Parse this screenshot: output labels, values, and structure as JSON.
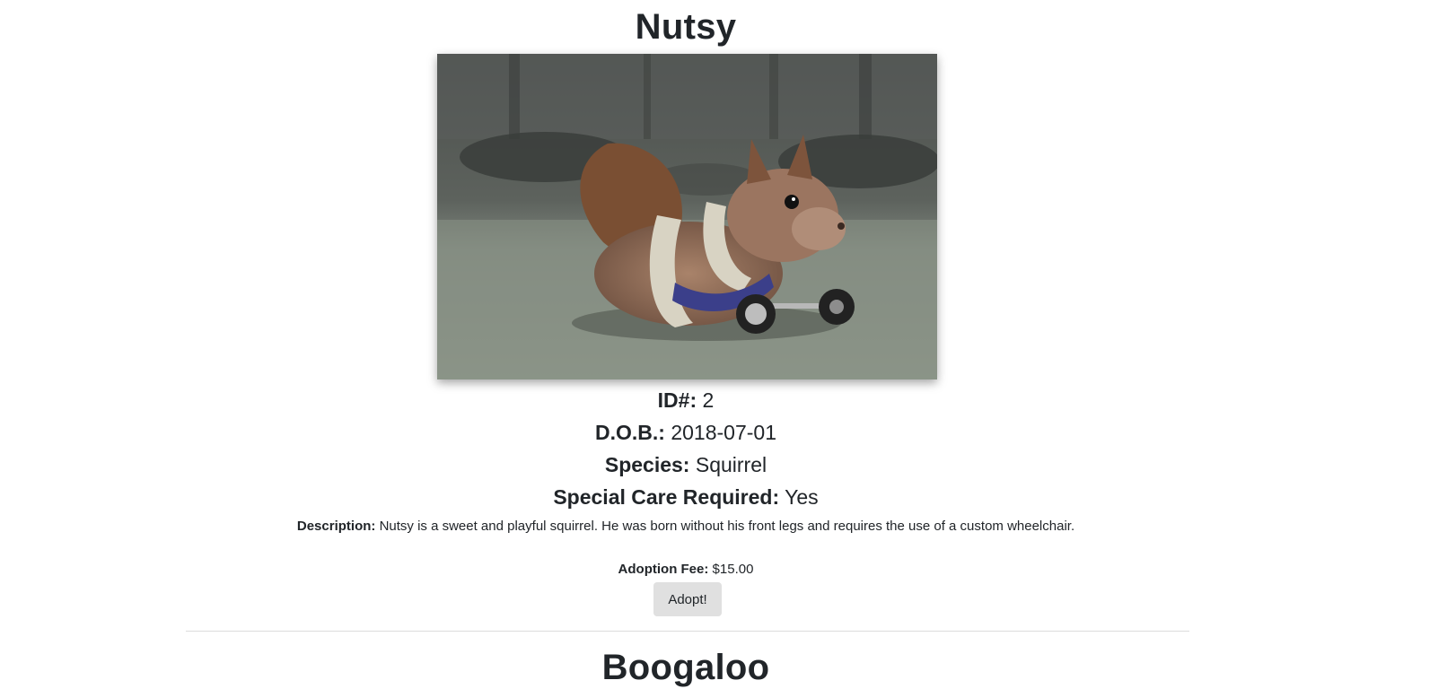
{
  "pets": [
    {
      "name": "Nutsy",
      "image_alt": "squirrel-with-wheelchair-photo",
      "id_label": "ID#:",
      "id_value": "2",
      "dob_label": "D.O.B.:",
      "dob_value": "2018-07-01",
      "species_label": "Species:",
      "species_value": "Squirrel",
      "special_care_label": "Special Care Required:",
      "special_care_value": "Yes",
      "description_label": "Description:",
      "description_value": "Nutsy is a sweet and playful squirrel. He was born without his front legs and requires the use of a custom wheelchair.",
      "fee_label": "Adoption Fee:",
      "fee_value": "$15.00",
      "adopt_label": "Adopt!"
    },
    {
      "name": "Boogaloo"
    }
  ],
  "colors": {
    "text": "#212529",
    "button_bg": "#e0e0e0",
    "divider": "#dcdcdc"
  }
}
